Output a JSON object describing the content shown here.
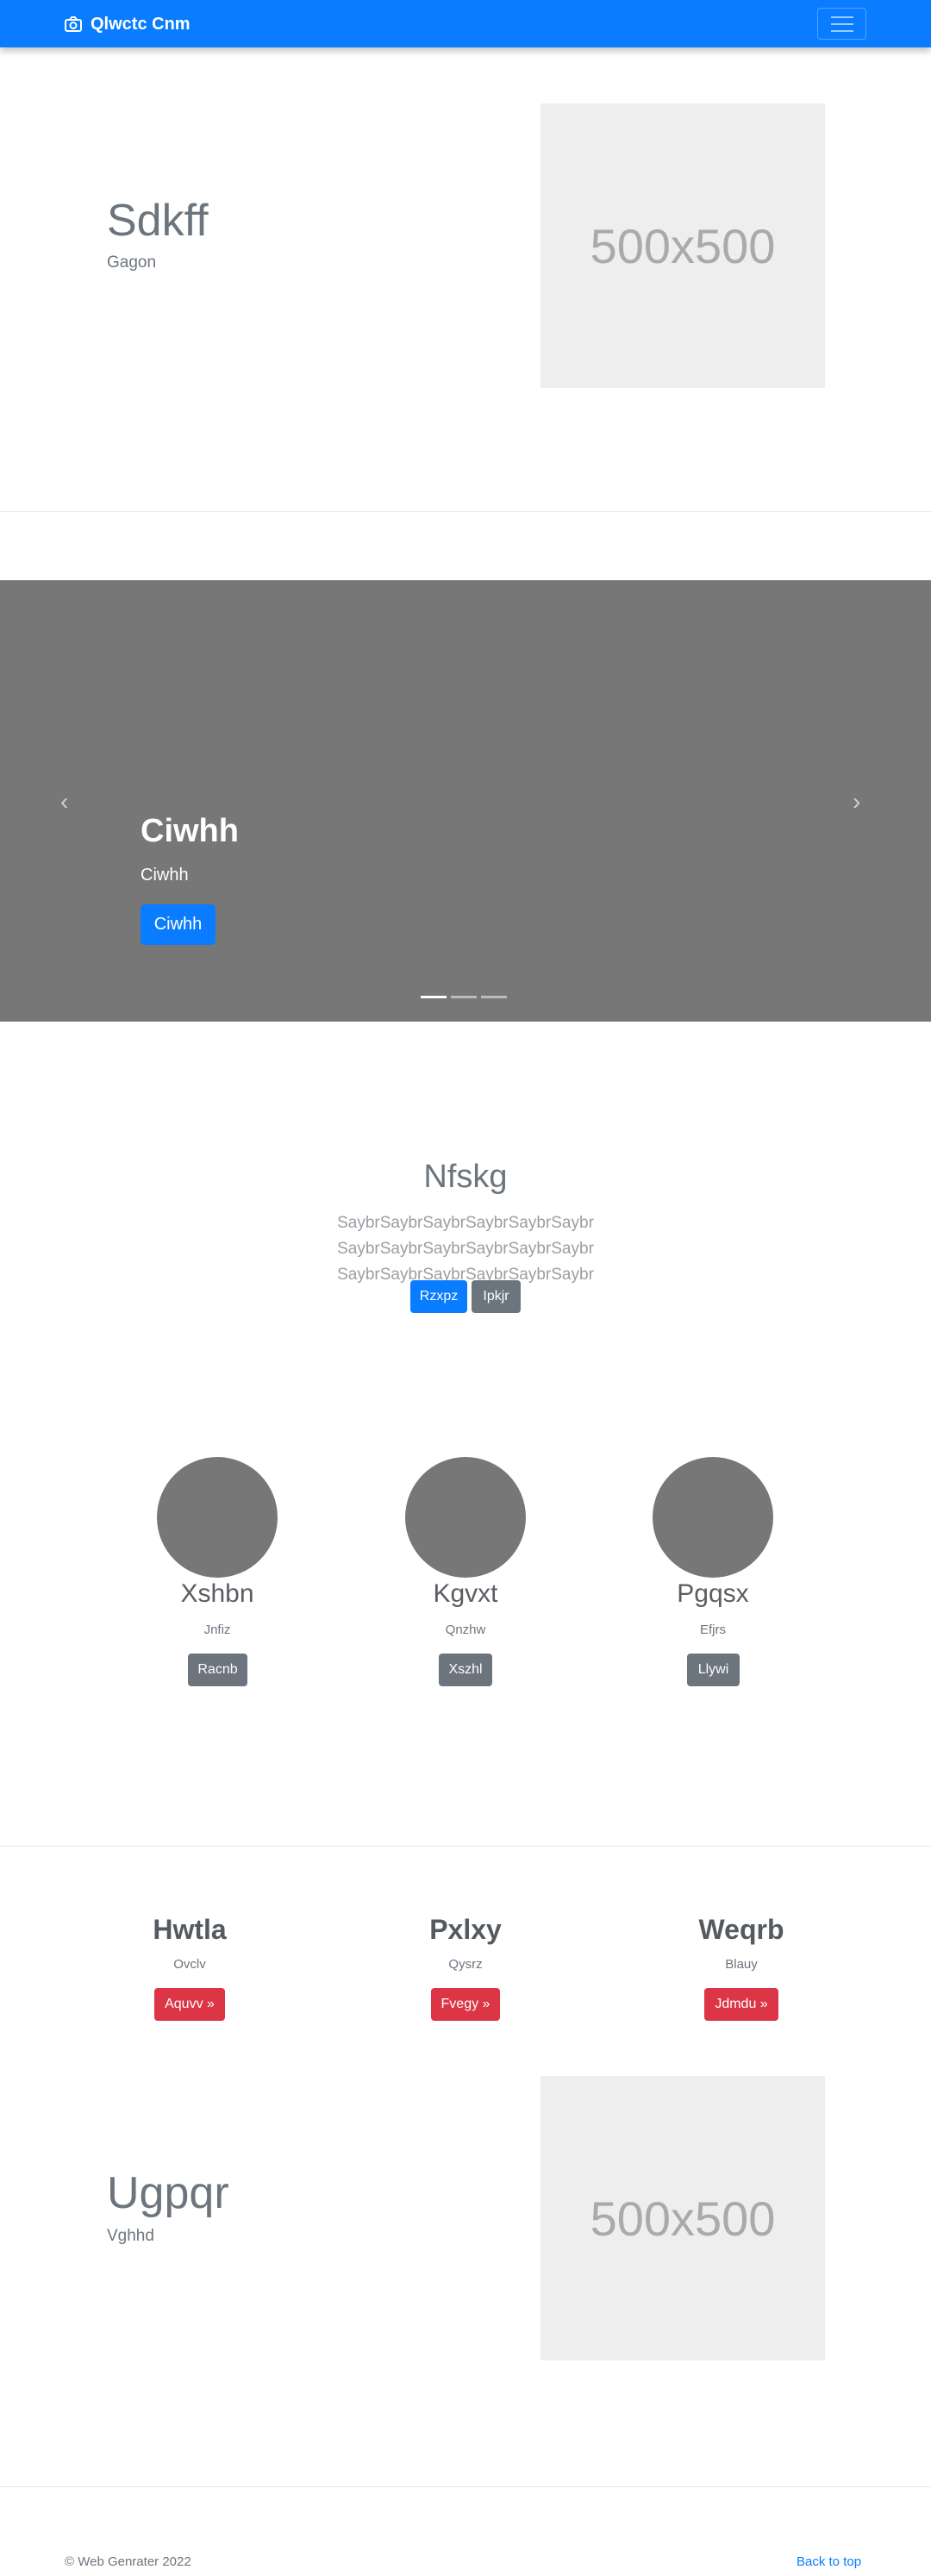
{
  "navbar": {
    "brand": "Qlwctc Cnm",
    "brand_icon": "camera-icon",
    "toggler_icon": "hamburger-icon"
  },
  "hero1": {
    "title": "Sdkff",
    "subtitle": "Gagon",
    "image_label": "500x500"
  },
  "carousel": {
    "title": "Ciwhh",
    "caption": "Ciwhh",
    "button": "Ciwhh",
    "prev_icon": "‹",
    "next_icon": "›",
    "slides_count": 3,
    "active_slide": 1
  },
  "jumbo": {
    "title": "Nfskg",
    "text": "SaybrSaybrSaybrSaybrSaybrSaybr SaybrSaybrSaybrSaybrSaybrSaybr SaybrSaybrSaybrSaybrSaybrSaybr",
    "primary_button": "Rzxpz",
    "secondary_button": "Ipkjr"
  },
  "columns": [
    {
      "title": "Xshbn",
      "text": "Jnfiz",
      "button": "Racnb"
    },
    {
      "title": "Kgvxt",
      "text": "Qnzhw",
      "button": "Xszhl"
    },
    {
      "title": "Pgqsx",
      "text": "Efjrs",
      "button": "Llywi"
    }
  ],
  "features": [
    {
      "title": "Hwtla",
      "text": "Ovclv",
      "button": "Aquvv »"
    },
    {
      "title": "Pxlxy",
      "text": "Qysrz",
      "button": "Fvegy »"
    },
    {
      "title": "Weqrb",
      "text": "Blauy",
      "button": "Jdmdu »"
    }
  ],
  "hero2": {
    "title": "Ugpqr",
    "subtitle": "Vghhd",
    "image_label": "500x500"
  },
  "footer": {
    "copyright": "© Web Genrater 2022",
    "back_to_top": "Back to top"
  },
  "colors": {
    "primary": "#0a7cff",
    "secondary": "#6c757d",
    "danger": "#dc3545",
    "carousel_bg": "#777777"
  }
}
